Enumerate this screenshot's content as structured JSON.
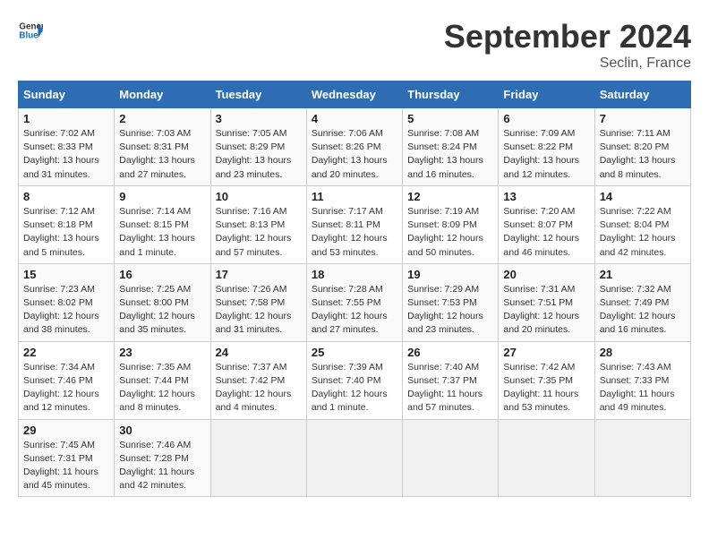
{
  "app": {
    "logo_line1": "General",
    "logo_line2": "Blue",
    "month": "September 2024",
    "location": "Seclin, France"
  },
  "calendar": {
    "headers": [
      "Sunday",
      "Monday",
      "Tuesday",
      "Wednesday",
      "Thursday",
      "Friday",
      "Saturday"
    ],
    "weeks": [
      [
        null,
        {
          "day": "2",
          "sunrise": "Sunrise: 7:03 AM",
          "sunset": "Sunset: 8:31 PM",
          "daylight": "Daylight: 13 hours and 27 minutes."
        },
        {
          "day": "3",
          "sunrise": "Sunrise: 7:05 AM",
          "sunset": "Sunset: 8:29 PM",
          "daylight": "Daylight: 13 hours and 23 minutes."
        },
        {
          "day": "4",
          "sunrise": "Sunrise: 7:06 AM",
          "sunset": "Sunset: 8:26 PM",
          "daylight": "Daylight: 13 hours and 20 minutes."
        },
        {
          "day": "5",
          "sunrise": "Sunrise: 7:08 AM",
          "sunset": "Sunset: 8:24 PM",
          "daylight": "Daylight: 13 hours and 16 minutes."
        },
        {
          "day": "6",
          "sunrise": "Sunrise: 7:09 AM",
          "sunset": "Sunset: 8:22 PM",
          "daylight": "Daylight: 13 hours and 12 minutes."
        },
        {
          "day": "7",
          "sunrise": "Sunrise: 7:11 AM",
          "sunset": "Sunset: 8:20 PM",
          "daylight": "Daylight: 13 hours and 8 minutes."
        }
      ],
      [
        {
          "day": "1",
          "sunrise": "Sunrise: 7:02 AM",
          "sunset": "Sunset: 8:33 PM",
          "daylight": "Daylight: 13 hours and 31 minutes."
        },
        {
          "day": "9",
          "sunrise": "Sunrise: 7:14 AM",
          "sunset": "Sunset: 8:15 PM",
          "daylight": "Daylight: 13 hours and 1 minute."
        },
        {
          "day": "10",
          "sunrise": "Sunrise: 7:16 AM",
          "sunset": "Sunset: 8:13 PM",
          "daylight": "Daylight: 12 hours and 57 minutes."
        },
        {
          "day": "11",
          "sunrise": "Sunrise: 7:17 AM",
          "sunset": "Sunset: 8:11 PM",
          "daylight": "Daylight: 12 hours and 53 minutes."
        },
        {
          "day": "12",
          "sunrise": "Sunrise: 7:19 AM",
          "sunset": "Sunset: 8:09 PM",
          "daylight": "Daylight: 12 hours and 50 minutes."
        },
        {
          "day": "13",
          "sunrise": "Sunrise: 7:20 AM",
          "sunset": "Sunset: 8:07 PM",
          "daylight": "Daylight: 12 hours and 46 minutes."
        },
        {
          "day": "14",
          "sunrise": "Sunrise: 7:22 AM",
          "sunset": "Sunset: 8:04 PM",
          "daylight": "Daylight: 12 hours and 42 minutes."
        }
      ],
      [
        {
          "day": "8",
          "sunrise": "Sunrise: 7:12 AM",
          "sunset": "Sunset: 8:18 PM",
          "daylight": "Daylight: 13 hours and 5 minutes."
        },
        {
          "day": "16",
          "sunrise": "Sunrise: 7:25 AM",
          "sunset": "Sunset: 8:00 PM",
          "daylight": "Daylight: 12 hours and 35 minutes."
        },
        {
          "day": "17",
          "sunrise": "Sunrise: 7:26 AM",
          "sunset": "Sunset: 7:58 PM",
          "daylight": "Daylight: 12 hours and 31 minutes."
        },
        {
          "day": "18",
          "sunrise": "Sunrise: 7:28 AM",
          "sunset": "Sunset: 7:55 PM",
          "daylight": "Daylight: 12 hours and 27 minutes."
        },
        {
          "day": "19",
          "sunrise": "Sunrise: 7:29 AM",
          "sunset": "Sunset: 7:53 PM",
          "daylight": "Daylight: 12 hours and 23 minutes."
        },
        {
          "day": "20",
          "sunrise": "Sunrise: 7:31 AM",
          "sunset": "Sunset: 7:51 PM",
          "daylight": "Daylight: 12 hours and 20 minutes."
        },
        {
          "day": "21",
          "sunrise": "Sunrise: 7:32 AM",
          "sunset": "Sunset: 7:49 PM",
          "daylight": "Daylight: 12 hours and 16 minutes."
        }
      ],
      [
        {
          "day": "15",
          "sunrise": "Sunrise: 7:23 AM",
          "sunset": "Sunset: 8:02 PM",
          "daylight": "Daylight: 12 hours and 38 minutes."
        },
        {
          "day": "23",
          "sunrise": "Sunrise: 7:35 AM",
          "sunset": "Sunset: 7:44 PM",
          "daylight": "Daylight: 12 hours and 8 minutes."
        },
        {
          "day": "24",
          "sunrise": "Sunrise: 7:37 AM",
          "sunset": "Sunset: 7:42 PM",
          "daylight": "Daylight: 12 hours and 4 minutes."
        },
        {
          "day": "25",
          "sunrise": "Sunrise: 7:39 AM",
          "sunset": "Sunset: 7:40 PM",
          "daylight": "Daylight: 12 hours and 1 minute."
        },
        {
          "day": "26",
          "sunrise": "Sunrise: 7:40 AM",
          "sunset": "Sunset: 7:37 PM",
          "daylight": "Daylight: 11 hours and 57 minutes."
        },
        {
          "day": "27",
          "sunrise": "Sunrise: 7:42 AM",
          "sunset": "Sunset: 7:35 PM",
          "daylight": "Daylight: 11 hours and 53 minutes."
        },
        {
          "day": "28",
          "sunrise": "Sunrise: 7:43 AM",
          "sunset": "Sunset: 7:33 PM",
          "daylight": "Daylight: 11 hours and 49 minutes."
        }
      ],
      [
        {
          "day": "22",
          "sunrise": "Sunrise: 7:34 AM",
          "sunset": "Sunset: 7:46 PM",
          "daylight": "Daylight: 12 hours and 12 minutes."
        },
        {
          "day": "30",
          "sunrise": "Sunrise: 7:46 AM",
          "sunset": "Sunset: 7:28 PM",
          "daylight": "Daylight: 11 hours and 42 minutes."
        },
        null,
        null,
        null,
        null,
        null
      ],
      [
        {
          "day": "29",
          "sunrise": "Sunrise: 7:45 AM",
          "sunset": "Sunset: 7:31 PM",
          "daylight": "Daylight: 11 hours and 45 minutes."
        },
        null,
        null,
        null,
        null,
        null,
        null
      ]
    ]
  }
}
